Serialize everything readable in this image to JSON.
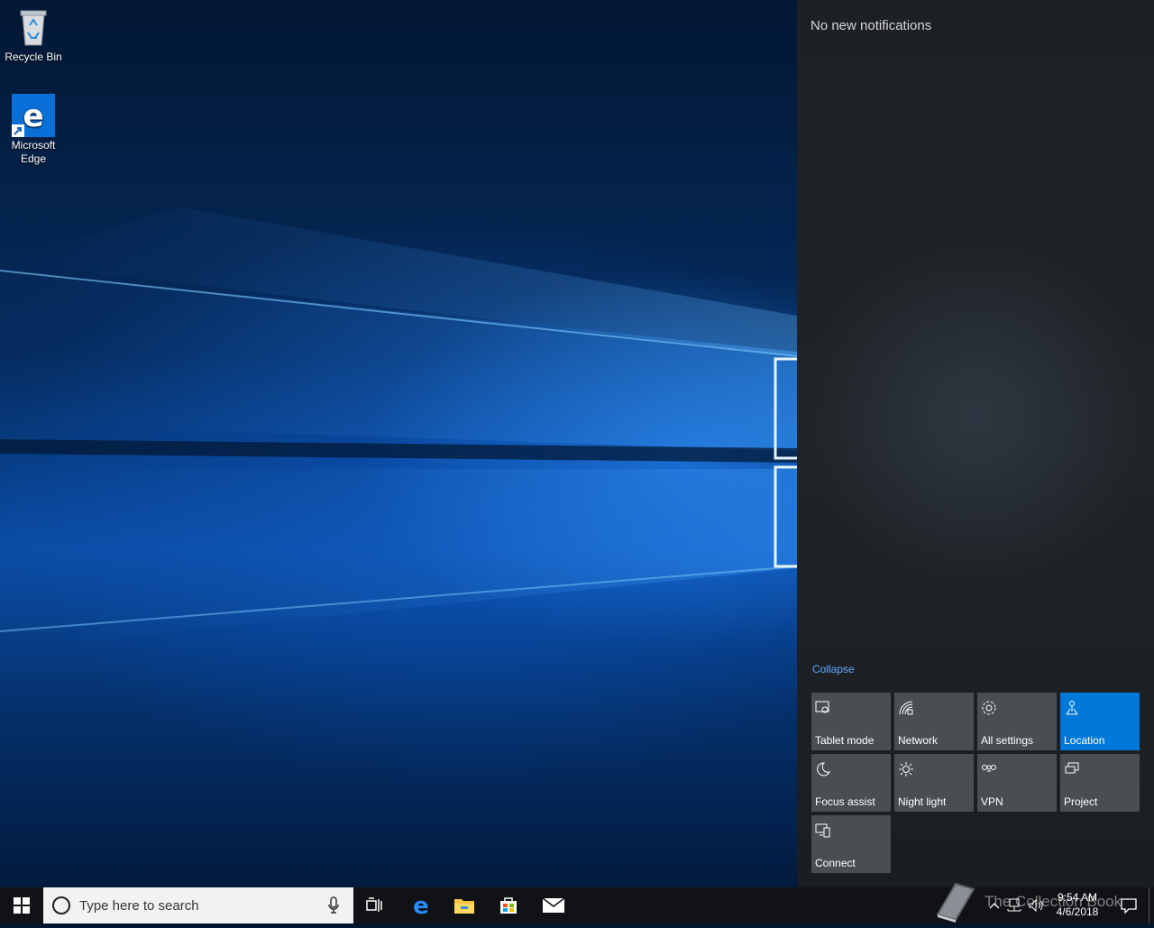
{
  "desktop": {
    "icons": [
      {
        "label": "Recycle Bin",
        "icon": "recycle-bin-icon"
      },
      {
        "label": "Microsoft Edge",
        "icon": "edge-icon"
      }
    ]
  },
  "action_center": {
    "notifications_text": "No new notifications",
    "collapse_label": "Collapse",
    "tiles": [
      {
        "label": "Tablet mode",
        "icon": "tablet-mode-icon",
        "active": false
      },
      {
        "label": "Network",
        "icon": "network-icon",
        "active": false
      },
      {
        "label": "All settings",
        "icon": "settings-gear-icon",
        "active": false
      },
      {
        "label": "Location",
        "icon": "location-icon",
        "active": true
      },
      {
        "label": "Focus assist",
        "icon": "moon-icon",
        "active": false
      },
      {
        "label": "Night light",
        "icon": "sun-icon",
        "active": false
      },
      {
        "label": "VPN",
        "icon": "vpn-icon",
        "active": false
      },
      {
        "label": "Project",
        "icon": "project-icon",
        "active": false
      },
      {
        "label": "Connect",
        "icon": "connect-icon",
        "active": false
      }
    ],
    "accent_color": "#0078d7"
  },
  "taskbar": {
    "search_placeholder": "Type here to search",
    "pinned": [
      "task-view-icon",
      "edge-icon",
      "file-explorer-icon",
      "store-icon",
      "mail-icon"
    ],
    "clock": {
      "time": "9:54 AM",
      "date": "4/6/2018"
    },
    "watermark": "The Collection Book"
  }
}
